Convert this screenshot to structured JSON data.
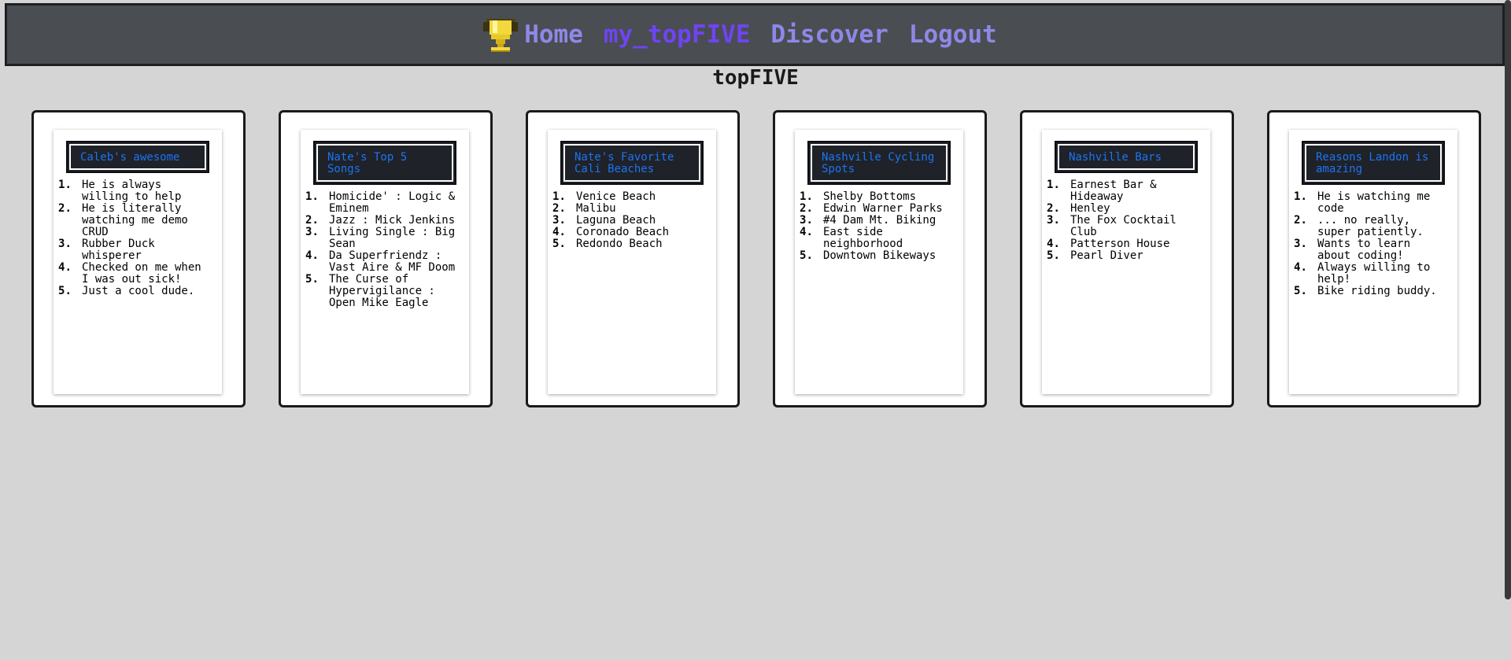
{
  "nav": {
    "logo_icon": "trophy-icon",
    "links": [
      {
        "label": "Home",
        "active": false
      },
      {
        "label": "my_topFIVE",
        "active": true
      },
      {
        "label": "Discover",
        "active": false
      },
      {
        "label": "Logout",
        "active": false
      }
    ],
    "colors": {
      "link": "#8e88e8",
      "active": "#6f44f3",
      "background": "#4a4d52"
    }
  },
  "page": {
    "title": "topFIVE",
    "background": "#d5d5d5"
  },
  "cards": [
    {
      "title": "Caleb's awesome",
      "items": [
        "He is always willing to help",
        "He is literally watching me demo CRUD",
        "Rubber Duck whisperer",
        "Checked on me when I was out sick!",
        "Just a cool dude."
      ]
    },
    {
      "title": "Nate's Top 5 Songs",
      "items": [
        "Homicide' : Logic & Eminem",
        "Jazz : Mick Jenkins",
        "Living Single : Big Sean",
        "Da Superfriendz : Vast Aire & MF Doom",
        "The Curse of Hypervigilance : Open Mike Eagle"
      ]
    },
    {
      "title": "Nate's Favorite Cali Beaches",
      "items": [
        "Venice Beach",
        "Malibu",
        "Laguna Beach",
        "Coronado Beach",
        "Redondo Beach"
      ]
    },
    {
      "title": "Nashville Cycling Spots",
      "items": [
        "Shelby Bottoms",
        "Edwin Warner Parks",
        "#4 Dam Mt. Biking",
        "East side neighborhood",
        "Downtown Bikeways"
      ]
    },
    {
      "title": "Nashville Bars",
      "items": [
        "Earnest Bar & Hideaway",
        "Henley",
        "The Fox Cocktail Club",
        "Patterson House",
        "Pearl Diver"
      ]
    },
    {
      "title": "Reasons Landon is amazing",
      "items": [
        "He is watching me code",
        "... no really, super patiently.",
        "Wants to learn about coding!",
        "Always willing to help!",
        "Bike riding buddy."
      ]
    }
  ]
}
